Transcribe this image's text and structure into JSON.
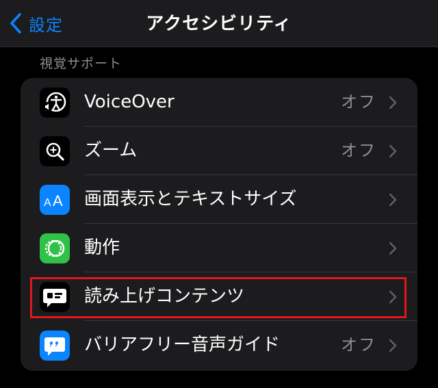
{
  "nav": {
    "back_label": "設定",
    "title": "アクセシビリティ"
  },
  "section": {
    "header": "視覚サポート"
  },
  "rows": [
    {
      "label": "VoiceOver",
      "value": "オフ",
      "icon": "voiceover-icon",
      "icon_color": "#000000"
    },
    {
      "label": "ズーム",
      "value": "オフ",
      "icon": "zoom-icon",
      "icon_color": "#000000"
    },
    {
      "label": "画面表示とテキストサイズ",
      "value": "",
      "icon": "text-size-icon",
      "icon_color": "#0a84ff"
    },
    {
      "label": "動作",
      "value": "",
      "icon": "motion-icon",
      "icon_color": "#30c248"
    },
    {
      "label": "読み上げコンテンツ",
      "value": "",
      "icon": "spoken-content-icon",
      "icon_color": "#000000"
    },
    {
      "label": "バリアフリー音声ガイド",
      "value": "オフ",
      "icon": "audio-descriptions-icon",
      "icon_color": "#0a84ff"
    }
  ],
  "colors": {
    "accent": "#0a84ff",
    "highlight": "#e4161b",
    "background": "#000000",
    "group_background": "#1c1c1e",
    "secondary_text": "#8e8e93"
  }
}
